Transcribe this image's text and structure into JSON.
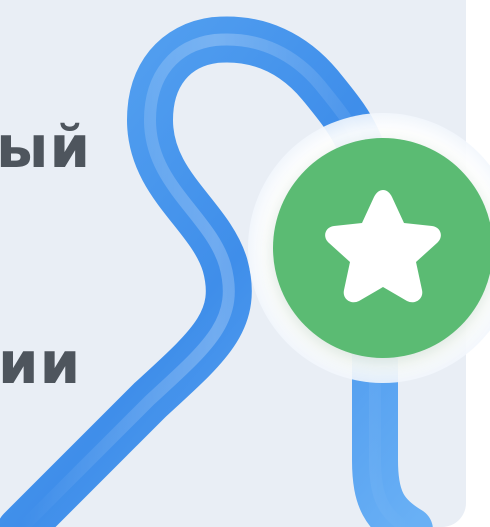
{
  "headline": {
    "line_1": "ый",
    "line_2": "ии"
  },
  "colors": {
    "panel_background": "#e9eef5",
    "text": "#4e555d",
    "route": "#4a97ec",
    "badge": "#5bbb73",
    "star": "#ffffff"
  },
  "badge": {
    "icon": "star-icon"
  }
}
